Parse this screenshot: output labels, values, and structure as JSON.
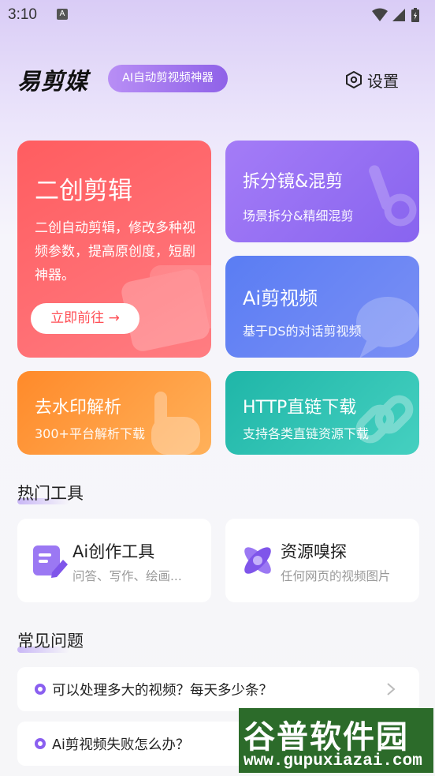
{
  "status_bar": {
    "time": "3:10",
    "notif_glyph": "A"
  },
  "header": {
    "logo": "易剪媒",
    "badge": "AI自动剪视频神器",
    "settings_label": "设置",
    "settings_icon": "hexagon-gear-icon"
  },
  "feature_cards": {
    "remix": {
      "title": "二创剪辑",
      "description": "二创自动剪辑，修改多种视频参数，提高原创度，短剧神器。",
      "button": "立即前往 →",
      "color": "#ff5d60"
    },
    "split": {
      "title": "拆分镜&混剪",
      "subtitle": "场景拆分&精细混剪",
      "color": "#9a72f4"
    },
    "ai_video": {
      "title": "Ai剪视频",
      "subtitle": "基于DS的对话剪视频",
      "color": "#6a86f4"
    },
    "watermark": {
      "title": "去水印解析",
      "subtitle": "300+平台解析下载",
      "color": "#ff9a3c"
    },
    "http": {
      "title": "HTTP直链下载",
      "subtitle": "支持各类直链资源下载",
      "color": "#2fc2b3"
    }
  },
  "hot_tools": {
    "title": "热门工具",
    "items": [
      {
        "title": "Ai创作工具",
        "subtitle": "问答、写作、绘画...",
        "icon": "document-edit-icon"
      },
      {
        "title": "资源嗅探",
        "subtitle": "任何网页的视频图片",
        "icon": "x-sniff-icon"
      }
    ]
  },
  "faq": {
    "title": "常见问题",
    "items": [
      {
        "text": "可以处理多大的视频？每天多少条？"
      },
      {
        "text": "Ai剪视频失败怎么办？"
      }
    ]
  },
  "watermark_overlay": {
    "main": "谷普软件园",
    "url": "www.gupuxiazai.com"
  },
  "accent_color": "#8a5ff0"
}
